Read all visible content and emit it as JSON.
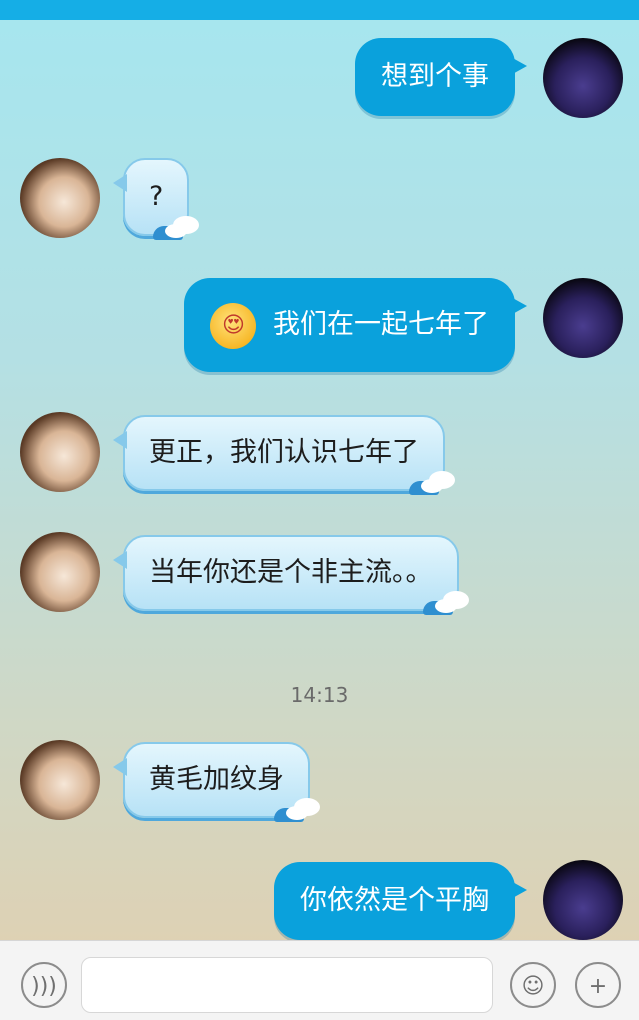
{
  "messages": [
    {
      "sender": "me",
      "text": "想到个事"
    },
    {
      "sender": "other",
      "text": "?"
    },
    {
      "sender": "me",
      "emoji": "😍",
      "text": "我们在一起七年了"
    },
    {
      "sender": "other",
      "text": "更正，我们认识七年了"
    },
    {
      "sender": "other",
      "text": "当年你还是个非主流。。"
    },
    {
      "timestamp": "14:13"
    },
    {
      "sender": "other",
      "text": "黄毛加纹身"
    },
    {
      "sender": "me",
      "text": "你依然是个平胸"
    }
  ],
  "input": {
    "value": "",
    "placeholder": ""
  },
  "icons": {
    "voice": "voice-icon",
    "emoji": "smiley-icon",
    "plus": "plus-icon"
  },
  "colors": {
    "topbar": "#15aee6",
    "my_bubble": "#0aa1dc",
    "other_bubble": "#c9ecfa",
    "other_bubble_border": "#86c9ea"
  }
}
